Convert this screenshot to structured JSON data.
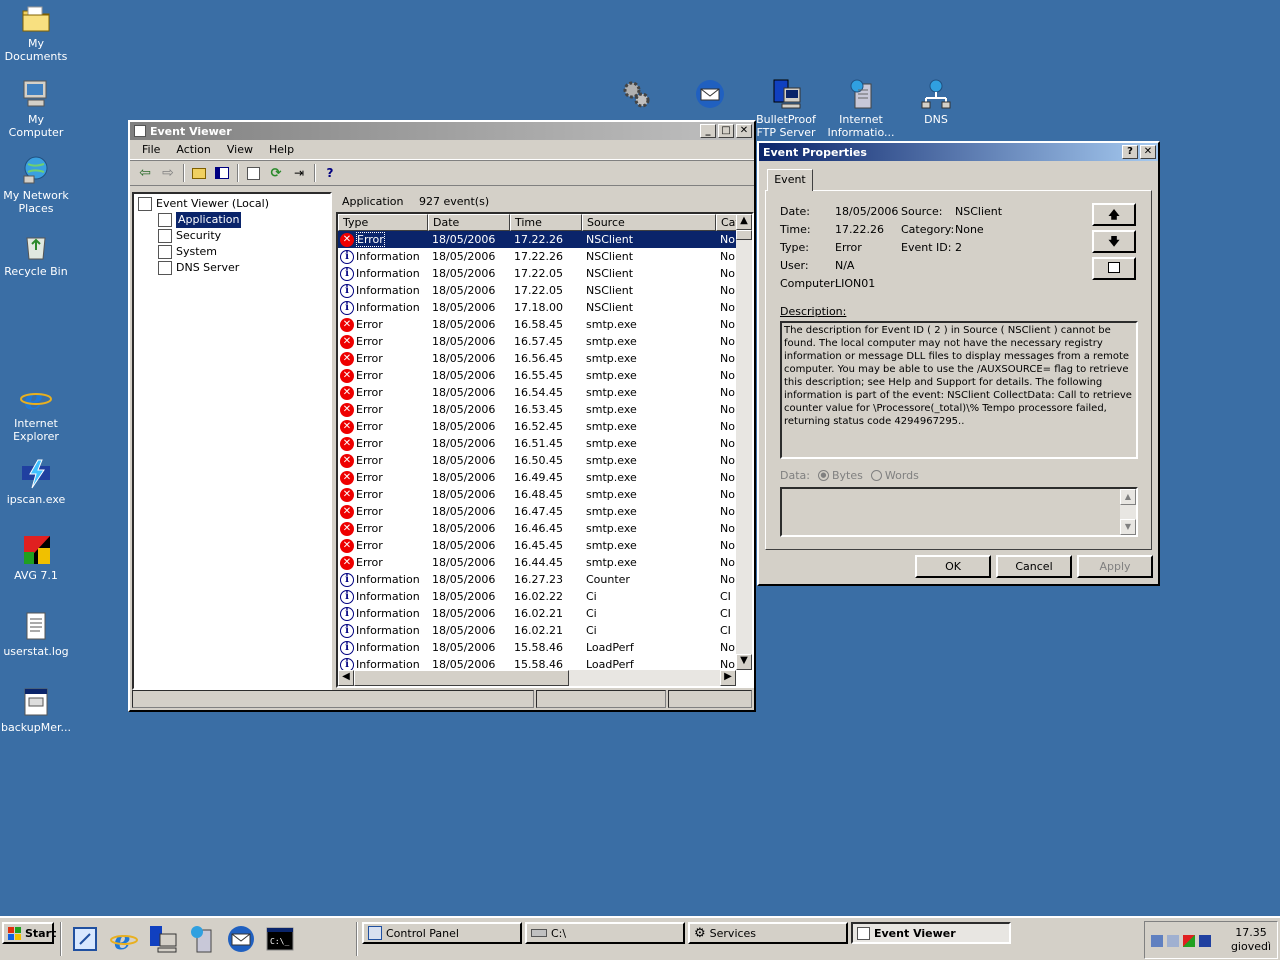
{
  "desktop": {
    "icons_left": [
      {
        "label": "My Documents",
        "icon": "folder-documents-icon"
      },
      {
        "label": "My Computer",
        "icon": "computer-icon"
      },
      {
        "label": "My Network Places",
        "icon": "network-icon"
      },
      {
        "label": "Recycle Bin",
        "icon": "recycle-bin-icon"
      },
      {
        "label": "Internet Explorer",
        "icon": "internet-explorer-icon"
      },
      {
        "label": "ipscan.exe",
        "icon": "ipscan-icon"
      },
      {
        "label": "AVG 7.1",
        "icon": "avg-icon"
      },
      {
        "label": "userstat.log",
        "icon": "text-file-icon"
      },
      {
        "label": "backupMer...",
        "icon": "script-file-icon"
      }
    ],
    "icons_top": [
      {
        "label": "BulletProof FTP Server",
        "icon": "ftp-server-icon"
      },
      {
        "label": "Internet Informatio...",
        "icon": "iis-icon"
      },
      {
        "label": "DNS",
        "icon": "dns-icon"
      }
    ]
  },
  "event_viewer": {
    "title": "Event Viewer",
    "menu": [
      "File",
      "Action",
      "View",
      "Help"
    ],
    "tree_root": "Event Viewer (Local)",
    "tree_items": [
      "Application",
      "Security",
      "System",
      "DNS Server"
    ],
    "list_title": "Application",
    "list_count": "927 event(s)",
    "columns": [
      "Type",
      "Date",
      "Time",
      "Source",
      "Cat"
    ],
    "rows": [
      {
        "type": "Error",
        "date": "18/05/2006",
        "time": "17.22.26",
        "source": "NSClient",
        "cat": "Nor"
      },
      {
        "type": "Information",
        "date": "18/05/2006",
        "time": "17.22.26",
        "source": "NSClient",
        "cat": "Nor"
      },
      {
        "type": "Information",
        "date": "18/05/2006",
        "time": "17.22.05",
        "source": "NSClient",
        "cat": "Nor"
      },
      {
        "type": "Information",
        "date": "18/05/2006",
        "time": "17.22.05",
        "source": "NSClient",
        "cat": "Nor"
      },
      {
        "type": "Information",
        "date": "18/05/2006",
        "time": "17.18.00",
        "source": "NSClient",
        "cat": "Nor"
      },
      {
        "type": "Error",
        "date": "18/05/2006",
        "time": "16.58.45",
        "source": "smtp.exe",
        "cat": "Nor"
      },
      {
        "type": "Error",
        "date": "18/05/2006",
        "time": "16.57.45",
        "source": "smtp.exe",
        "cat": "Nor"
      },
      {
        "type": "Error",
        "date": "18/05/2006",
        "time": "16.56.45",
        "source": "smtp.exe",
        "cat": "Nor"
      },
      {
        "type": "Error",
        "date": "18/05/2006",
        "time": "16.55.45",
        "source": "smtp.exe",
        "cat": "Nor"
      },
      {
        "type": "Error",
        "date": "18/05/2006",
        "time": "16.54.45",
        "source": "smtp.exe",
        "cat": "Nor"
      },
      {
        "type": "Error",
        "date": "18/05/2006",
        "time": "16.53.45",
        "source": "smtp.exe",
        "cat": "Nor"
      },
      {
        "type": "Error",
        "date": "18/05/2006",
        "time": "16.52.45",
        "source": "smtp.exe",
        "cat": "Nor"
      },
      {
        "type": "Error",
        "date": "18/05/2006",
        "time": "16.51.45",
        "source": "smtp.exe",
        "cat": "Nor"
      },
      {
        "type": "Error",
        "date": "18/05/2006",
        "time": "16.50.45",
        "source": "smtp.exe",
        "cat": "Nor"
      },
      {
        "type": "Error",
        "date": "18/05/2006",
        "time": "16.49.45",
        "source": "smtp.exe",
        "cat": "Nor"
      },
      {
        "type": "Error",
        "date": "18/05/2006",
        "time": "16.48.45",
        "source": "smtp.exe",
        "cat": "Nor"
      },
      {
        "type": "Error",
        "date": "18/05/2006",
        "time": "16.47.45",
        "source": "smtp.exe",
        "cat": "Nor"
      },
      {
        "type": "Error",
        "date": "18/05/2006",
        "time": "16.46.45",
        "source": "smtp.exe",
        "cat": "Nor"
      },
      {
        "type": "Error",
        "date": "18/05/2006",
        "time": "16.45.45",
        "source": "smtp.exe",
        "cat": "Nor"
      },
      {
        "type": "Error",
        "date": "18/05/2006",
        "time": "16.44.45",
        "source": "smtp.exe",
        "cat": "Nor"
      },
      {
        "type": "Information",
        "date": "18/05/2006",
        "time": "16.27.23",
        "source": "Counter",
        "cat": "Nor"
      },
      {
        "type": "Information",
        "date": "18/05/2006",
        "time": "16.02.22",
        "source": "Ci",
        "cat": "CI"
      },
      {
        "type": "Information",
        "date": "18/05/2006",
        "time": "16.02.21",
        "source": "Ci",
        "cat": "CI"
      },
      {
        "type": "Information",
        "date": "18/05/2006",
        "time": "16.02.21",
        "source": "Ci",
        "cat": "CI"
      },
      {
        "type": "Information",
        "date": "18/05/2006",
        "time": "15.58.46",
        "source": "LoadPerf",
        "cat": "Nor"
      },
      {
        "type": "Information",
        "date": "18/05/2006",
        "time": "15.58.46",
        "source": "LoadPerf",
        "cat": "Nor"
      }
    ]
  },
  "event_properties": {
    "title": "Event Properties",
    "tab": "Event",
    "date_label": "Date:",
    "date": "18/05/2006",
    "source_label": "Source:",
    "source": "NSClient",
    "time_label": "Time:",
    "time": "17.22.26",
    "category_label": "Category:",
    "category": "None",
    "type_label": "Type:",
    "type": "Error",
    "event_id_label": "Event ID:",
    "event_id": "2",
    "user_label": "User:",
    "user": "N/A",
    "computer_label": "Computer:",
    "computer": "LION01",
    "description_label": "Description:",
    "description": "The description for Event ID ( 2 ) in Source ( NSClient ) cannot be found. The local computer may not have the necessary registry information or message DLL files to display messages from a remote computer. You may be able to use the /AUXSOURCE= flag to retrieve this description; see Help and Support for details. The following information is part of the event: NSClient CollectData: Call to retrieve counter value for \\Processore(_total)\\% Tempo processore failed, returning status code 4294967295..",
    "data_label": "Data:",
    "bytes_label": "Bytes",
    "words_label": "Words",
    "ok": "OK",
    "cancel": "Cancel",
    "apply": "Apply"
  },
  "taskbar": {
    "start": "Start",
    "tasks": [
      "Control Panel",
      "C:\\",
      "Services",
      "Event Viewer"
    ],
    "clock_time": "17.35",
    "clock_day": "giovedì"
  }
}
